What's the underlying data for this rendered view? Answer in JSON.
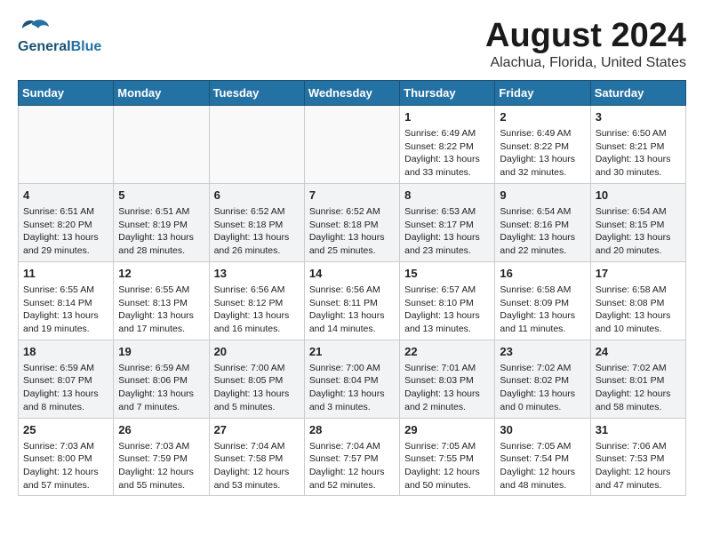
{
  "header": {
    "logo_general": "General",
    "logo_blue": "Blue",
    "month_title": "August 2024",
    "location": "Alachua, Florida, United States"
  },
  "weekdays": [
    "Sunday",
    "Monday",
    "Tuesday",
    "Wednesday",
    "Thursday",
    "Friday",
    "Saturday"
  ],
  "weeks": [
    [
      {
        "day": "",
        "empty": true
      },
      {
        "day": "",
        "empty": true
      },
      {
        "day": "",
        "empty": true
      },
      {
        "day": "",
        "empty": true
      },
      {
        "day": "1",
        "sunrise": "6:49 AM",
        "sunset": "8:22 PM",
        "daylight": "13 hours and 33 minutes."
      },
      {
        "day": "2",
        "sunrise": "6:49 AM",
        "sunset": "8:22 PM",
        "daylight": "13 hours and 32 minutes."
      },
      {
        "day": "3",
        "sunrise": "6:50 AM",
        "sunset": "8:21 PM",
        "daylight": "13 hours and 30 minutes."
      }
    ],
    [
      {
        "day": "4",
        "sunrise": "6:51 AM",
        "sunset": "8:20 PM",
        "daylight": "13 hours and 29 minutes."
      },
      {
        "day": "5",
        "sunrise": "6:51 AM",
        "sunset": "8:19 PM",
        "daylight": "13 hours and 28 minutes."
      },
      {
        "day": "6",
        "sunrise": "6:52 AM",
        "sunset": "8:18 PM",
        "daylight": "13 hours and 26 minutes."
      },
      {
        "day": "7",
        "sunrise": "6:52 AM",
        "sunset": "8:18 PM",
        "daylight": "13 hours and 25 minutes."
      },
      {
        "day": "8",
        "sunrise": "6:53 AM",
        "sunset": "8:17 PM",
        "daylight": "13 hours and 23 minutes."
      },
      {
        "day": "9",
        "sunrise": "6:54 AM",
        "sunset": "8:16 PM",
        "daylight": "13 hours and 22 minutes."
      },
      {
        "day": "10",
        "sunrise": "6:54 AM",
        "sunset": "8:15 PM",
        "daylight": "13 hours and 20 minutes."
      }
    ],
    [
      {
        "day": "11",
        "sunrise": "6:55 AM",
        "sunset": "8:14 PM",
        "daylight": "13 hours and 19 minutes."
      },
      {
        "day": "12",
        "sunrise": "6:55 AM",
        "sunset": "8:13 PM",
        "daylight": "13 hours and 17 minutes."
      },
      {
        "day": "13",
        "sunrise": "6:56 AM",
        "sunset": "8:12 PM",
        "daylight": "13 hours and 16 minutes."
      },
      {
        "day": "14",
        "sunrise": "6:56 AM",
        "sunset": "8:11 PM",
        "daylight": "13 hours and 14 minutes."
      },
      {
        "day": "15",
        "sunrise": "6:57 AM",
        "sunset": "8:10 PM",
        "daylight": "13 hours and 13 minutes."
      },
      {
        "day": "16",
        "sunrise": "6:58 AM",
        "sunset": "8:09 PM",
        "daylight": "13 hours and 11 minutes."
      },
      {
        "day": "17",
        "sunrise": "6:58 AM",
        "sunset": "8:08 PM",
        "daylight": "13 hours and 10 minutes."
      }
    ],
    [
      {
        "day": "18",
        "sunrise": "6:59 AM",
        "sunset": "8:07 PM",
        "daylight": "13 hours and 8 minutes."
      },
      {
        "day": "19",
        "sunrise": "6:59 AM",
        "sunset": "8:06 PM",
        "daylight": "13 hours and 7 minutes."
      },
      {
        "day": "20",
        "sunrise": "7:00 AM",
        "sunset": "8:05 PM",
        "daylight": "13 hours and 5 minutes."
      },
      {
        "day": "21",
        "sunrise": "7:00 AM",
        "sunset": "8:04 PM",
        "daylight": "13 hours and 3 minutes."
      },
      {
        "day": "22",
        "sunrise": "7:01 AM",
        "sunset": "8:03 PM",
        "daylight": "13 hours and 2 minutes."
      },
      {
        "day": "23",
        "sunrise": "7:02 AM",
        "sunset": "8:02 PM",
        "daylight": "13 hours and 0 minutes."
      },
      {
        "day": "24",
        "sunrise": "7:02 AM",
        "sunset": "8:01 PM",
        "daylight": "12 hours and 58 minutes."
      }
    ],
    [
      {
        "day": "25",
        "sunrise": "7:03 AM",
        "sunset": "8:00 PM",
        "daylight": "12 hours and 57 minutes."
      },
      {
        "day": "26",
        "sunrise": "7:03 AM",
        "sunset": "7:59 PM",
        "daylight": "12 hours and 55 minutes."
      },
      {
        "day": "27",
        "sunrise": "7:04 AM",
        "sunset": "7:58 PM",
        "daylight": "12 hours and 53 minutes."
      },
      {
        "day": "28",
        "sunrise": "7:04 AM",
        "sunset": "7:57 PM",
        "daylight": "12 hours and 52 minutes."
      },
      {
        "day": "29",
        "sunrise": "7:05 AM",
        "sunset": "7:55 PM",
        "daylight": "12 hours and 50 minutes."
      },
      {
        "day": "30",
        "sunrise": "7:05 AM",
        "sunset": "7:54 PM",
        "daylight": "12 hours and 48 minutes."
      },
      {
        "day": "31",
        "sunrise": "7:06 AM",
        "sunset": "7:53 PM",
        "daylight": "12 hours and 47 minutes."
      }
    ]
  ],
  "labels": {
    "sunrise": "Sunrise:",
    "sunset": "Sunset:",
    "daylight": "Daylight:"
  }
}
